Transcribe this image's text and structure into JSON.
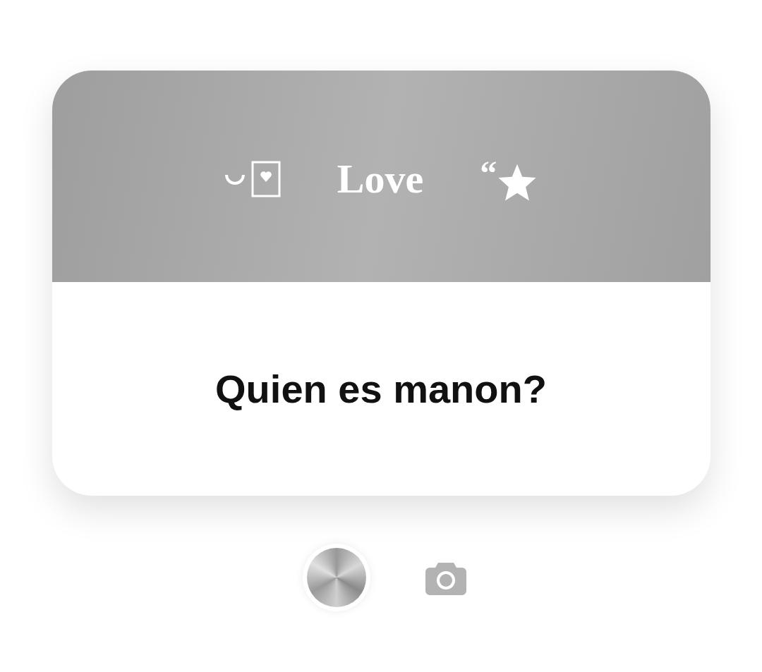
{
  "card": {
    "header": {
      "title": "Love",
      "quote_mark": "“"
    },
    "question": "Quien es manon?"
  }
}
